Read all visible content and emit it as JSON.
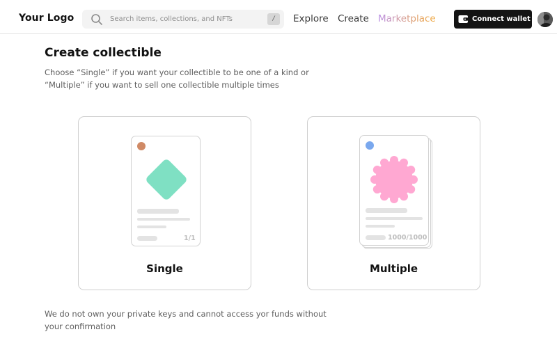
{
  "header": {
    "logo": "Your Logo",
    "search": {
      "placeholder": "Search items, collections, and NFTs",
      "shortcut": "/"
    },
    "nav": {
      "explore": "Explore",
      "create": "Create",
      "marketplace": "Marketplace"
    },
    "wallet_button": "Connect wallet",
    "marketplace_gradient": [
      "#b98ee6",
      "#f0a83c"
    ]
  },
  "main": {
    "title": "Create collectible",
    "subtitle": "Choose “Single” if you want your collectible to be one of a kind or “Multiple” if you want to sell one collectible multiple times",
    "options": [
      {
        "label": "Single",
        "edition": "1/1",
        "dot_color": "#d08a66",
        "art_color": "#7fe0c3",
        "art_shape": "diamond"
      },
      {
        "label": "Multiple",
        "edition": "1000/1000",
        "dot_color": "#7aa8ee",
        "art_color": "#ffa8d2",
        "art_shape": "starburst"
      }
    ],
    "footnote": "We do not own your private keys and cannot access yor funds without your confirmation"
  }
}
